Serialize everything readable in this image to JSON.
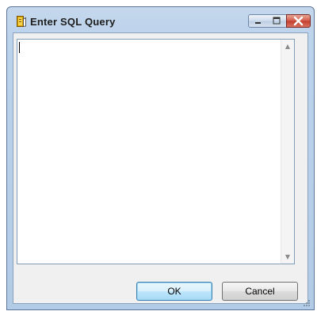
{
  "window": {
    "title": "Enter SQL Query"
  },
  "editor": {
    "value": ""
  },
  "buttons": {
    "ok_label": "OK",
    "cancel_label": "Cancel"
  },
  "icons": {
    "app": "sql-book-icon",
    "minimize": "minimize-icon",
    "maximize": "maximize-icon",
    "close": "close-icon",
    "scroll_up": "scroll-up-arrow-icon",
    "scroll_down": "scroll-down-arrow-icon",
    "resize_grip": "resize-grip-icon"
  },
  "colors": {
    "title_bar": "#bcd3ec",
    "close_button": "#c9483a",
    "ok_button_border": "#3c7fb1"
  }
}
